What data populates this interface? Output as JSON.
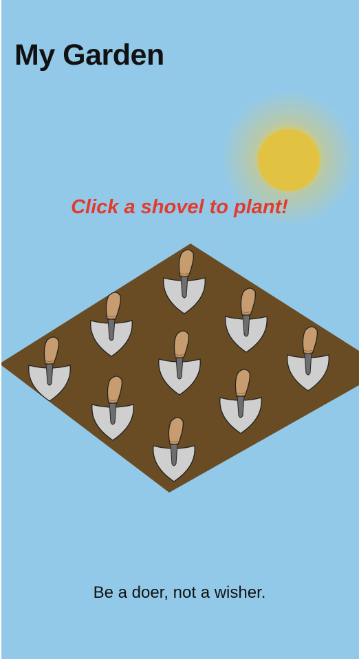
{
  "header": {
    "title": "My Garden"
  },
  "instruction": {
    "text": "Click a shovel to plant!"
  },
  "footer": {
    "quote": "Be a doer, not a wisher."
  },
  "garden": {
    "plot_count": 9,
    "items": [
      "shovel",
      "shovel",
      "shovel",
      "shovel",
      "shovel",
      "shovel",
      "shovel",
      "shovel",
      "shovel"
    ]
  },
  "colors": {
    "sky": "#93c9e8",
    "soil": "#694c24",
    "sun": "#e2c243",
    "instruction_text": "#e23b2e",
    "shovel_blade": "#cfcfcf",
    "shovel_handle": "#c79c6e",
    "shovel_shaft": "#6e6e6e"
  }
}
